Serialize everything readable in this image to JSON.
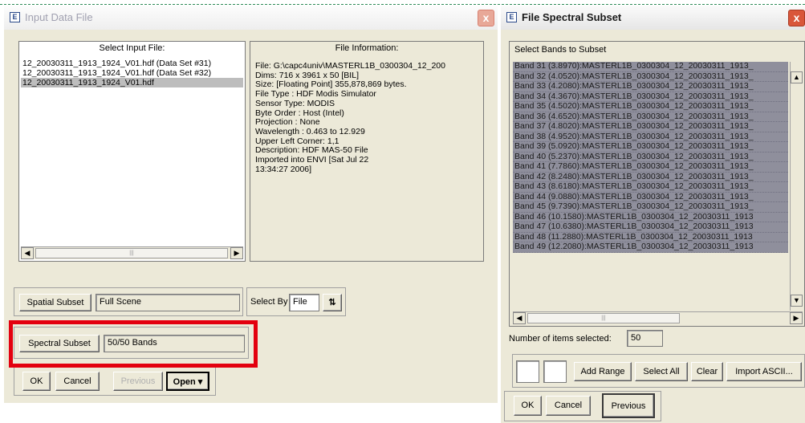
{
  "input_dialog": {
    "title": "Input Data File",
    "close_label": "x",
    "select_header": "Select Input File:",
    "files": [
      "12_20030311_1913_1924_V01.hdf (Data Set #31)",
      "12_20030311_1913_1924_V01.hdf (Data Set #32)",
      "12_20030311_1913_1924_V01.hdf"
    ],
    "info_header": "File Information:",
    "info_lines": [
      "File: G:\\capc4univ\\MASTERL1B_0300304_12_200",
      "Dims: 716 x 3961 x 50 [BIL]",
      "Size: [Floating Point] 355,878,869 bytes.",
      "File Type  : HDF Modis Simulator",
      "Sensor Type: MODIS",
      "Byte Order : Host (Intel)",
      "Projection : None",
      "Wavelength : 0.463 to 12.929",
      "Upper Left Corner: 1,1",
      "Description: HDF MAS-50 File",
      "Imported into ENVI [Sat Jul 22",
      "13:34:27 2006]"
    ],
    "spatial_subset_label": "Spatial Subset",
    "spatial_subset_value": "Full Scene",
    "select_by_label": "Select By",
    "select_by_value": "File",
    "sort_icon": "sort-arrows",
    "spectral_subset_label": "Spectral Subset",
    "spectral_subset_value": "50/50 Bands",
    "ok_label": "OK",
    "cancel_label": "Cancel",
    "previous_label": "Previous",
    "open_label": "Open ▾"
  },
  "spectral_dialog": {
    "title": "File Spectral Subset",
    "close_label": "x",
    "select_header": "Select Bands to Subset",
    "bands": [
      "Band 31 (3.8970):MASTERL1B_0300304_12_20030311_1913_",
      "Band 32 (4.0520):MASTERL1B_0300304_12_20030311_1913_",
      "Band 33 (4.2080):MASTERL1B_0300304_12_20030311_1913_",
      "Band 34 (4.3670):MASTERL1B_0300304_12_20030311_1913_",
      "Band 35 (4.5020):MASTERL1B_0300304_12_20030311_1913_",
      "Band 36 (4.6520):MASTERL1B_0300304_12_20030311_1913_",
      "Band 37 (4.8020):MASTERL1B_0300304_12_20030311_1913_",
      "Band 38 (4.9520):MASTERL1B_0300304_12_20030311_1913_",
      "Band 39 (5.0920):MASTERL1B_0300304_12_20030311_1913_",
      "Band 40 (5.2370):MASTERL1B_0300304_12_20030311_1913_",
      "Band 41 (7.7860):MASTERL1B_0300304_12_20030311_1913_",
      "Band 42 (8.2480):MASTERL1B_0300304_12_20030311_1913_",
      "Band 43 (8.6180):MASTERL1B_0300304_12_20030311_1913_",
      "Band 44 (9.0880):MASTERL1B_0300304_12_20030311_1913_",
      "Band 45 (9.7390):MASTERL1B_0300304_12_20030311_1913_",
      "Band 46 (10.1580):MASTERL1B_0300304_12_20030311_1913",
      "Band 47 (10.6380):MASTERL1B_0300304_12_20030311_1913",
      "Band 48 (11.2880):MASTERL1B_0300304_12_20030311_1913",
      "Band 49 (12.2080):MASTERL1B_0300304_12_20030311_1913"
    ],
    "items_selected_label": "Number of items selected:",
    "items_selected_value": "50",
    "add_range_label": "Add Range",
    "select_all_label": "Select All",
    "clear_label": "Clear",
    "import_ascii_label": "Import ASCII...",
    "ok_label": "OK",
    "cancel_label": "Cancel",
    "previous_label": "Previous"
  },
  "colors": {
    "highlight": "#e3000f",
    "selection": "#8f8f9c",
    "close_button": "#d9563a"
  }
}
